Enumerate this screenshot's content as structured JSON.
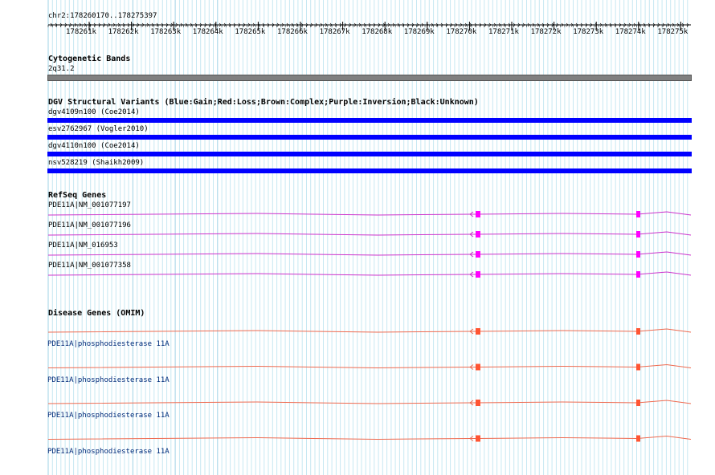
{
  "region_label": "chr2:178260170..178275397",
  "ruler": {
    "ticks": [
      "178261k",
      "178262k",
      "178263k",
      "178264k",
      "178265k",
      "178266k",
      "178267k",
      "178268k",
      "178269k",
      "178270k",
      "178271k",
      "178272k",
      "178273k",
      "178274k",
      "178275k"
    ]
  },
  "cytoband": {
    "title": "Cytogenetic Bands",
    "band": "2q31.2",
    "color": "#808080"
  },
  "dgv": {
    "title": "DGV Structural Variants (Blue:Gain;Red:Loss;Brown:Complex;Purple:Inversion;Black:Unknown)",
    "color": "#0000ff",
    "items": [
      {
        "label": "dgv4109n100 (Coe2014)"
      },
      {
        "label": "esv2762967 (Vogler2010)"
      },
      {
        "label": "dgv4110n100 (Coe2014)"
      },
      {
        "label": "nsv528219 (Shaikh2009)"
      }
    ]
  },
  "refseq": {
    "title": "RefSeq Genes",
    "color": "#cc33cc",
    "exon_color": "#ff00ff",
    "items": [
      {
        "label": "PDE11A|NM_001077197"
      },
      {
        "label": "PDE11A|NM_001077196"
      },
      {
        "label": "PDE11A|NM_016953"
      },
      {
        "label": "PDE11A|NM_001077358"
      }
    ]
  },
  "omim": {
    "title": "Disease Genes (OMIM)",
    "color": "#ee6a50",
    "exon_color": "#ff5533",
    "items": [
      {
        "label": "PDE11A|phosphodiesterase 11A"
      },
      {
        "label": "PDE11A|phosphodiesterase 11A"
      },
      {
        "label": "PDE11A|phosphodiesterase 11A"
      },
      {
        "label": "PDE11A|phosphodiesterase 11A"
      }
    ]
  }
}
